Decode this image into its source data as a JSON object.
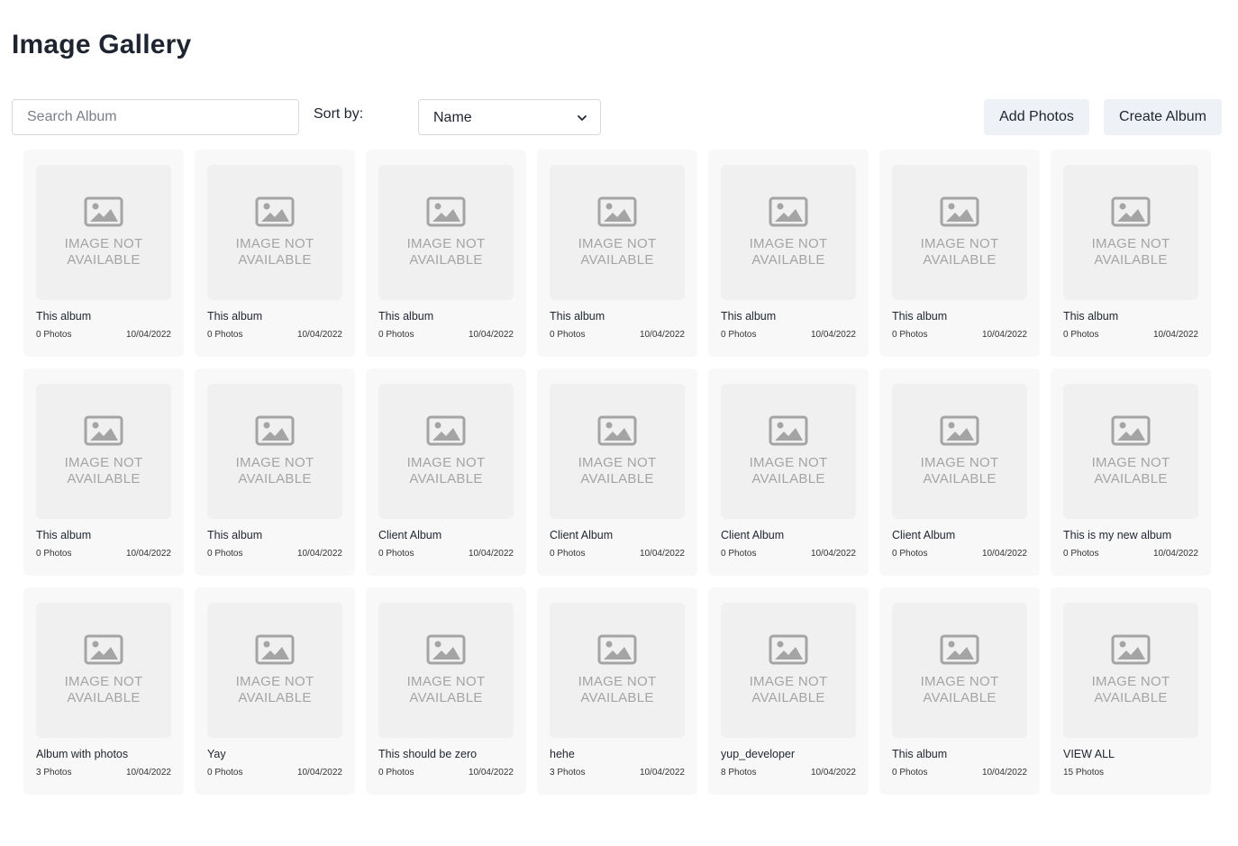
{
  "page": {
    "title": "Image Gallery"
  },
  "toolbar": {
    "search_placeholder": "Search Album",
    "sort_label": "Sort by:",
    "sort_value": "Name",
    "add_photos_label": "Add Photos",
    "create_album_label": "Create Album"
  },
  "placeholder_text": {
    "line1": "IMAGE NOT",
    "line2": "AVAILABLE"
  },
  "albums": [
    {
      "title": "This album",
      "count": "0 Photos",
      "date": "10/04/2022"
    },
    {
      "title": "This album",
      "count": "0 Photos",
      "date": "10/04/2022"
    },
    {
      "title": "This album",
      "count": "0 Photos",
      "date": "10/04/2022"
    },
    {
      "title": "This album",
      "count": "0 Photos",
      "date": "10/04/2022"
    },
    {
      "title": "This album",
      "count": "0 Photos",
      "date": "10/04/2022"
    },
    {
      "title": "This album",
      "count": "0 Photos",
      "date": "10/04/2022"
    },
    {
      "title": "This album",
      "count": "0 Photos",
      "date": "10/04/2022"
    },
    {
      "title": "This album",
      "count": "0 Photos",
      "date": "10/04/2022"
    },
    {
      "title": "This album",
      "count": "0 Photos",
      "date": "10/04/2022"
    },
    {
      "title": "Client Album",
      "count": "0 Photos",
      "date": "10/04/2022"
    },
    {
      "title": "Client Album",
      "count": "0 Photos",
      "date": "10/04/2022"
    },
    {
      "title": "Client Album",
      "count": "0 Photos",
      "date": "10/04/2022"
    },
    {
      "title": "Client Album",
      "count": "0 Photos",
      "date": "10/04/2022"
    },
    {
      "title": "This is my new album",
      "count": "0 Photos",
      "date": "10/04/2022"
    },
    {
      "title": "Album with photos",
      "count": "3 Photos",
      "date": "10/04/2022"
    },
    {
      "title": "Yay",
      "count": "0 Photos",
      "date": "10/04/2022"
    },
    {
      "title": "This should be zero",
      "count": "0 Photos",
      "date": "10/04/2022"
    },
    {
      "title": "hehe",
      "count": "3 Photos",
      "date": "10/04/2022"
    },
    {
      "title": "yup_developer",
      "count": "8 Photos",
      "date": "10/04/2022"
    },
    {
      "title": "This album",
      "count": "0 Photos",
      "date": "10/04/2022"
    },
    {
      "title": "VIEW ALL",
      "count": "15 Photos",
      "date": ""
    }
  ],
  "icons": {
    "placeholder": "image-icon",
    "select_arrow": "chevron-down-icon"
  },
  "colors": {
    "button_bg": "#eef2f6",
    "card_bg": "#f8f8f8",
    "thumb_bg": "#f0f0f0",
    "placeholder_gray": "#a4a4a4"
  }
}
